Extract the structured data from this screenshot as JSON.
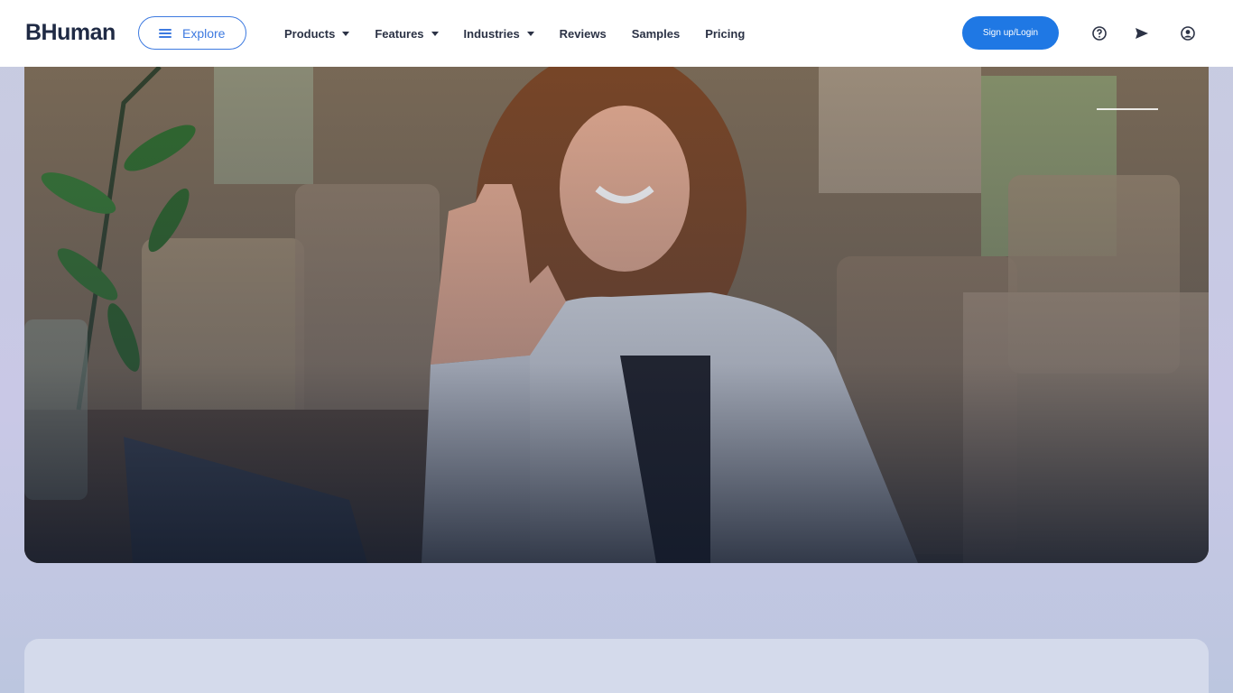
{
  "header": {
    "logo": "BHuman",
    "explore_label": "Explore",
    "nav": [
      {
        "label": "Products",
        "has_dropdown": true
      },
      {
        "label": "Features",
        "has_dropdown": true
      },
      {
        "label": "Industries",
        "has_dropdown": true
      },
      {
        "label": "Reviews",
        "has_dropdown": false
      },
      {
        "label": "Samples",
        "has_dropdown": false
      },
      {
        "label": "Pricing",
        "has_dropdown": false
      }
    ],
    "signup_label": "Sign up/Login",
    "icons": [
      "help-icon",
      "send-icon",
      "user-icon"
    ]
  },
  "colors": {
    "accent": "#1f78e4",
    "explore_border": "#3d7ae0",
    "nav_text": "#2b3245",
    "logo": "#1f2a44"
  }
}
